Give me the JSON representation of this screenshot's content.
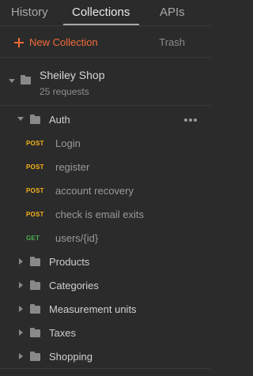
{
  "tabs": {
    "history": "History",
    "collections": "Collections",
    "apis": "APIs"
  },
  "toolbar": {
    "new_collection": "New Collection",
    "trash": "Trash"
  },
  "collection": {
    "name": "Sheiley Shop",
    "count": "25 requests"
  },
  "tree": {
    "auth": {
      "label": "Auth",
      "requests": [
        {
          "method": "POST",
          "name": "Login"
        },
        {
          "method": "POST",
          "name": "register"
        },
        {
          "method": "POST",
          "name": "account recovery"
        },
        {
          "method": "POST",
          "name": "check is email exits"
        },
        {
          "method": "GET",
          "name": "users/{id}"
        }
      ]
    },
    "folders": [
      {
        "label": "Products"
      },
      {
        "label": "Categories"
      },
      {
        "label": "Measurement units"
      },
      {
        "label": "Taxes"
      },
      {
        "label": "Shopping"
      }
    ]
  },
  "colors": {
    "accent": "#f26b3a",
    "post": "#f7b21b",
    "get": "#4caf50",
    "background": "#2b2b2b"
  }
}
